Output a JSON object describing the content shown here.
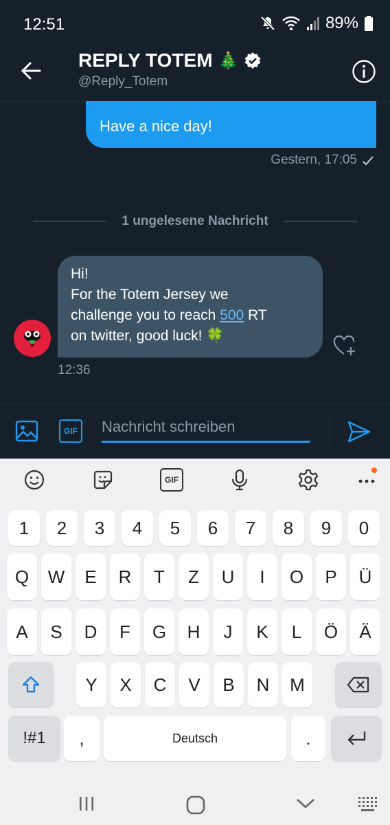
{
  "status_bar": {
    "time": "12:51",
    "battery": "89%"
  },
  "header": {
    "title": "REPLY TOTEM",
    "title_emoji": "🎄",
    "handle": "@Reply_Totem"
  },
  "conversation": {
    "outgoing": {
      "text": "Have a nice day!",
      "time": "Gestern, 17:05"
    },
    "unread_divider": "1 ungelesene Nachricht",
    "incoming": {
      "line1": "Hi!",
      "line2": "For the Totem Jersey we",
      "line3_a": "challenge you to reach ",
      "line3_link": "500",
      "line3_b": " RT",
      "line4": "on twitter, good luck! 🍀",
      "time": "12:36"
    }
  },
  "composer": {
    "placeholder": "Nachricht schreiben",
    "gif_label": "GIF"
  },
  "keyboard": {
    "toolbar_gif": "GIF",
    "row_numbers": [
      "1",
      "2",
      "3",
      "4",
      "5",
      "6",
      "7",
      "8",
      "9",
      "0"
    ],
    "row1": [
      "Q",
      "W",
      "E",
      "R",
      "T",
      "Z",
      "U",
      "I",
      "O",
      "P",
      "Ü"
    ],
    "row2": [
      "A",
      "S",
      "D",
      "F",
      "G",
      "H",
      "J",
      "K",
      "L",
      "Ö",
      "Ä"
    ],
    "row3": [
      "Y",
      "X",
      "C",
      "V",
      "B",
      "N",
      "M"
    ],
    "symbols_key": "!#1",
    "comma_key": ",",
    "space_key": "Deutsch",
    "period_key": "."
  },
  "colors": {
    "background": "#15202b",
    "accent": "#1d9bf0",
    "incoming_bubble": "#3d5466",
    "avatar": "#e3203c"
  }
}
